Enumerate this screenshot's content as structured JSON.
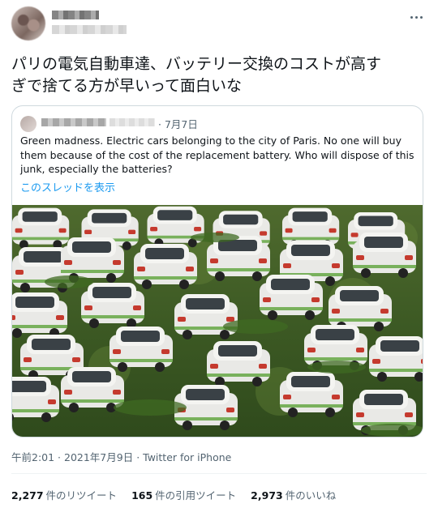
{
  "tweet": {
    "text": "パリの電気自動車達、バッテリー交換のコストが高す\nぎで捨てる方が早いって面白いな"
  },
  "quote": {
    "date": "· 7月7日",
    "text": "Green madness. Electric cars belonging to the city of Paris. No one will buy them because of the cost of the replacement battery. Who will dispose of this junk, especially the batteries?",
    "thread_link": "このスレッドを表示"
  },
  "meta": {
    "timestamp": "午前2:01 · 2021年7月9日",
    "separator": " · ",
    "source": "Twitter for iPhone"
  },
  "stats": [
    {
      "count": "2,277",
      "label": "件のリツイート"
    },
    {
      "count": "165",
      "label": "件の引用ツイート"
    },
    {
      "count": "2,973",
      "label": "件のいいね"
    }
  ],
  "colors": {
    "link": "#1d9bf0",
    "muted": "#536471",
    "border": "#cfd9de"
  },
  "icons": {
    "more": "more-horizontal-icon"
  }
}
